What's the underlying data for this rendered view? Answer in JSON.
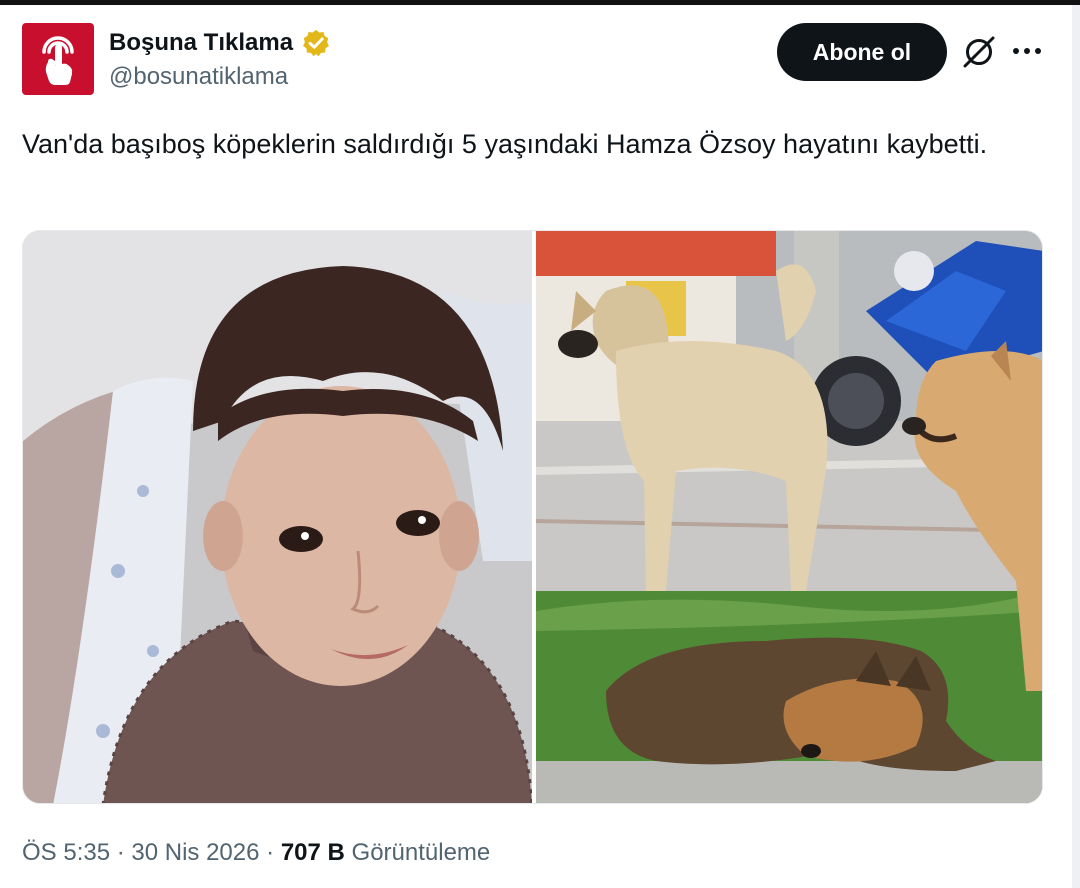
{
  "account": {
    "display_name": "Boşuna Tıklama",
    "handle": "@bosunatiklama",
    "avatar_icon": "tap-hand-icon",
    "avatar_color": "#c8102e",
    "verified_icon": "verified-badge-icon",
    "verified_color": "#e2b719"
  },
  "actions": {
    "follow_label": "Abone ol",
    "grok_icon": "grok-icon",
    "more_icon": "more-options-icon"
  },
  "tweet": {
    "text": "Van'da başıboş köpeklerin saldırdığı 5 yaşındaki Hamza Özsoy hayatını kaybetti."
  },
  "media": {
    "photos": [
      {
        "subject": "child-portrait-photo"
      },
      {
        "subject": "stray-dogs-photo"
      }
    ]
  },
  "meta": {
    "time": "ÖS 5:35",
    "separator": " · ",
    "date": "30 Nis 2026",
    "views_count": "707 B",
    "views_label": "Görüntüleme"
  }
}
